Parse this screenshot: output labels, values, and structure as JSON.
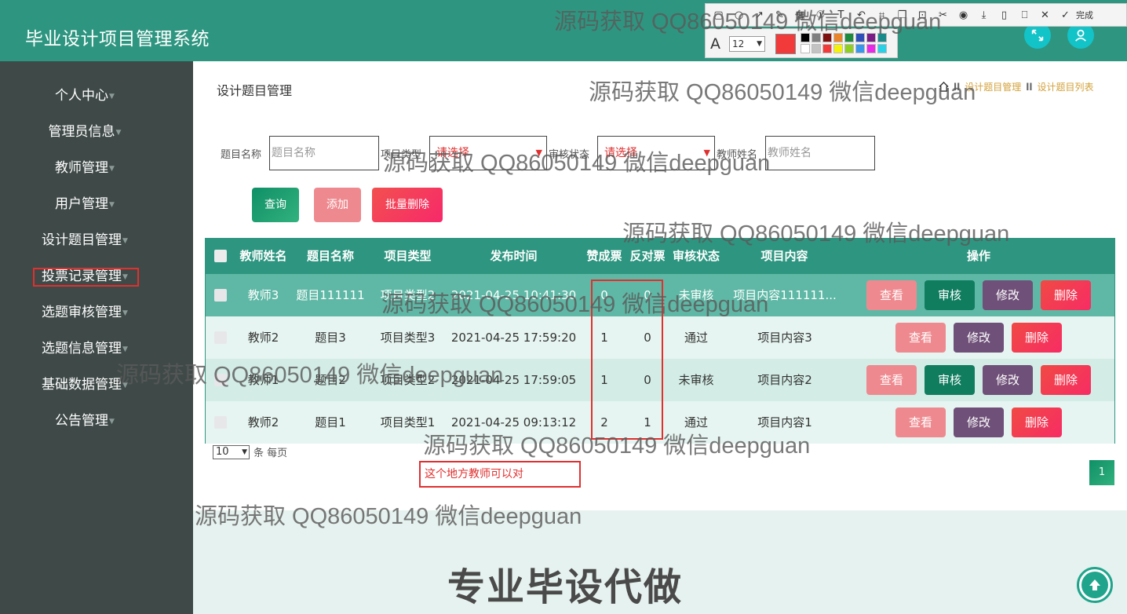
{
  "app": {
    "title": "毕业设计项目管理系统"
  },
  "snip_toolbar": {
    "done_label": "完成",
    "font_letter": "A",
    "font_size": "12"
  },
  "sidebar": {
    "items": [
      {
        "label": "个人中心"
      },
      {
        "label": "管理员信息"
      },
      {
        "label": "教师管理"
      },
      {
        "label": "用户管理"
      },
      {
        "label": "设计题目管理"
      },
      {
        "label": "投票记录管理"
      },
      {
        "label": "选题审核管理"
      },
      {
        "label": "选题信息管理"
      },
      {
        "label": "基础数据管理"
      },
      {
        "label": "公告管理"
      }
    ]
  },
  "page": {
    "title": "设计题目管理",
    "breadcrumb": [
      "设计题目管理",
      "设计题目列表"
    ]
  },
  "filters": {
    "topic_name_label": "题目名称",
    "topic_name_placeholder": "题目名称",
    "project_type_label": "项目类型",
    "project_type_value": "请选择",
    "audit_status_label": "审核状态",
    "audit_status_value": "请选择",
    "teacher_name_label": "教师姓名",
    "teacher_name_placeholder": "教师姓名"
  },
  "buttons": {
    "query": "查询",
    "add": "添加",
    "batch_delete": "批量删除"
  },
  "table": {
    "columns": [
      "教师姓名",
      "题目名称",
      "项目类型",
      "发布时间",
      "赞成票",
      "反对票",
      "审核状态",
      "项目内容",
      "操作"
    ],
    "rows": [
      {
        "teacher": "教师3",
        "topic": "题目111111",
        "type": "项目类型2",
        "time": "2021-04-25 10:41:30",
        "yes": "0",
        "no": "0",
        "status": "未审核",
        "content": "项目内容111111...",
        "actions": [
          "查看",
          "审核",
          "修改",
          "删除"
        ]
      },
      {
        "teacher": "教师2",
        "topic": "题目3",
        "type": "项目类型3",
        "time": "2021-04-25 17:59:20",
        "yes": "1",
        "no": "0",
        "status": "通过",
        "content": "项目内容3",
        "actions": [
          "查看",
          "修改",
          "删除"
        ]
      },
      {
        "teacher": "教师1",
        "topic": "题目2",
        "type": "项目类型2",
        "time": "2021-04-25 17:59:05",
        "yes": "1",
        "no": "0",
        "status": "未审核",
        "content": "项目内容2",
        "actions": [
          "查看",
          "审核",
          "修改",
          "删除"
        ]
      },
      {
        "teacher": "教师2",
        "topic": "题目1",
        "type": "项目类型1",
        "time": "2021-04-25 09:13:12",
        "yes": "2",
        "no": "1",
        "status": "通过",
        "content": "项目内容1",
        "actions": [
          "查看",
          "修改",
          "删除"
        ]
      }
    ]
  },
  "pager": {
    "page_size": "10",
    "suffix": "条 每页",
    "current_page": "1"
  },
  "annotation_note": "这个地方教师可以对",
  "watermark": "源码获取 QQ86050149 微信deepguan",
  "promo": "专业毕设代做",
  "colors": {
    "header": "#2e9680",
    "sidebar": "#3f4a48",
    "accent_red": "#e0302f"
  }
}
